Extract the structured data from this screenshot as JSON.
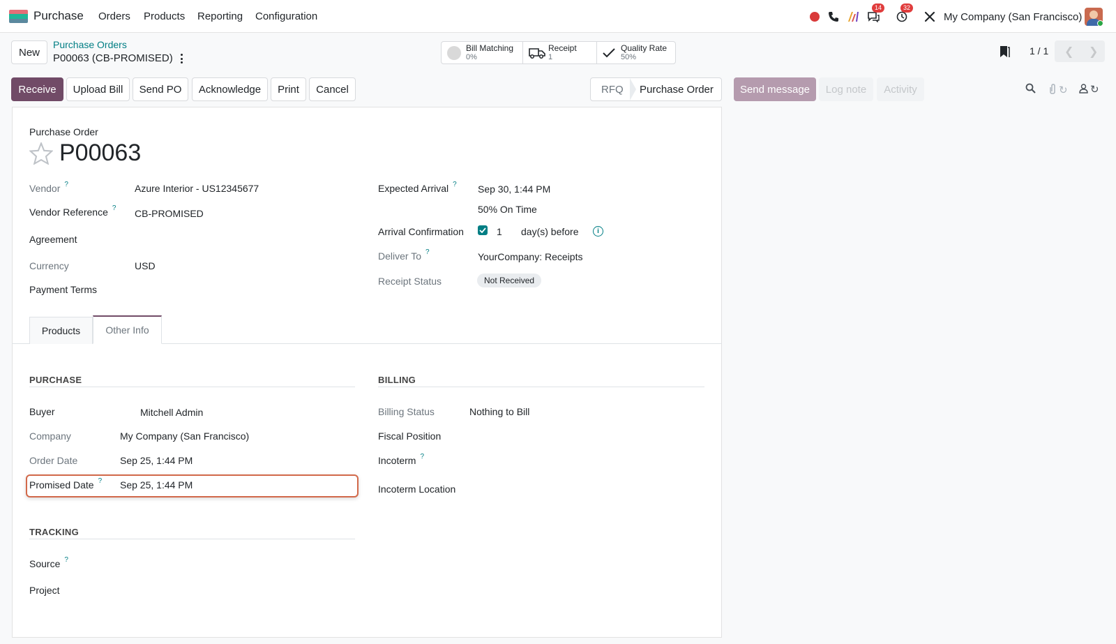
{
  "navbar": {
    "app_name": "Purchase",
    "menus": [
      "Orders",
      "Products",
      "Reporting",
      "Configuration"
    ],
    "messages_count": "14",
    "activities_count": "32",
    "company": "My Company (San Francisco)"
  },
  "control": {
    "new_label": "New",
    "breadcrumb": "Purchase Orders",
    "record_name": "P00063 (CB-PROMISED)",
    "pager": "1 / 1"
  },
  "smart_buttons": {
    "bill_matching": {
      "title": "Bill Matching",
      "value": "0%"
    },
    "receipt": {
      "title": "Receipt",
      "value": "1"
    },
    "quality_rate": {
      "title": "Quality Rate",
      "value": "50%"
    }
  },
  "actions": [
    "Receive",
    "Upload Bill",
    "Send PO",
    "Acknowledge",
    "Print",
    "Cancel"
  ],
  "status": {
    "rfq": "RFQ",
    "purchase_order": "Purchase Order"
  },
  "chatter": {
    "send_message": "Send message",
    "log_note": "Log note",
    "activity": "Activity"
  },
  "form": {
    "doc_type": "Purchase Order",
    "name": "P00063",
    "left": {
      "vendor_label": "Vendor",
      "vendor_value": "Azure Interior - US12345677",
      "vendor_ref_label": "Vendor Reference",
      "vendor_ref_value": "CB-PROMISED",
      "agreement_label": "Agreement",
      "currency_label": "Currency",
      "currency_value": "USD",
      "payment_terms_label": "Payment Terms"
    },
    "right": {
      "expected_arrival_label": "Expected Arrival",
      "expected_arrival_value": "Sep 30, 1:44 PM",
      "on_time": "50% On Time",
      "arrival_conf_label": "Arrival Confirmation",
      "arrival_conf_days": "1",
      "arrival_conf_suffix": "day(s) before",
      "deliver_to_label": "Deliver To",
      "deliver_to_value": "YourCompany: Receipts",
      "receipt_status_label": "Receipt Status",
      "receipt_status_value": "Not Received"
    },
    "tabs": [
      "Products",
      "Other Info"
    ],
    "purchase": {
      "title": "PURCHASE",
      "buyer_label": "Buyer",
      "buyer_value": "Mitchell Admin",
      "company_label": "Company",
      "company_value": "My Company (San Francisco)",
      "order_date_label": "Order Date",
      "order_date_value": "Sep 25, 1:44 PM",
      "promised_label": "Promised Date",
      "promised_value": "Sep 25, 1:44 PM"
    },
    "tracking": {
      "title": "TRACKING",
      "source_label": "Source",
      "project_label": "Project"
    },
    "billing": {
      "title": "BILLING",
      "billing_status_label": "Billing Status",
      "billing_status_value": "Nothing to Bill",
      "fiscal_label": "Fiscal Position",
      "incoterm_label": "Incoterm",
      "incoterm_loc_label": "Incoterm Location"
    }
  },
  "colors": {
    "brand": "#714b67",
    "link": "#017e84",
    "highlight": "#d2694a"
  }
}
